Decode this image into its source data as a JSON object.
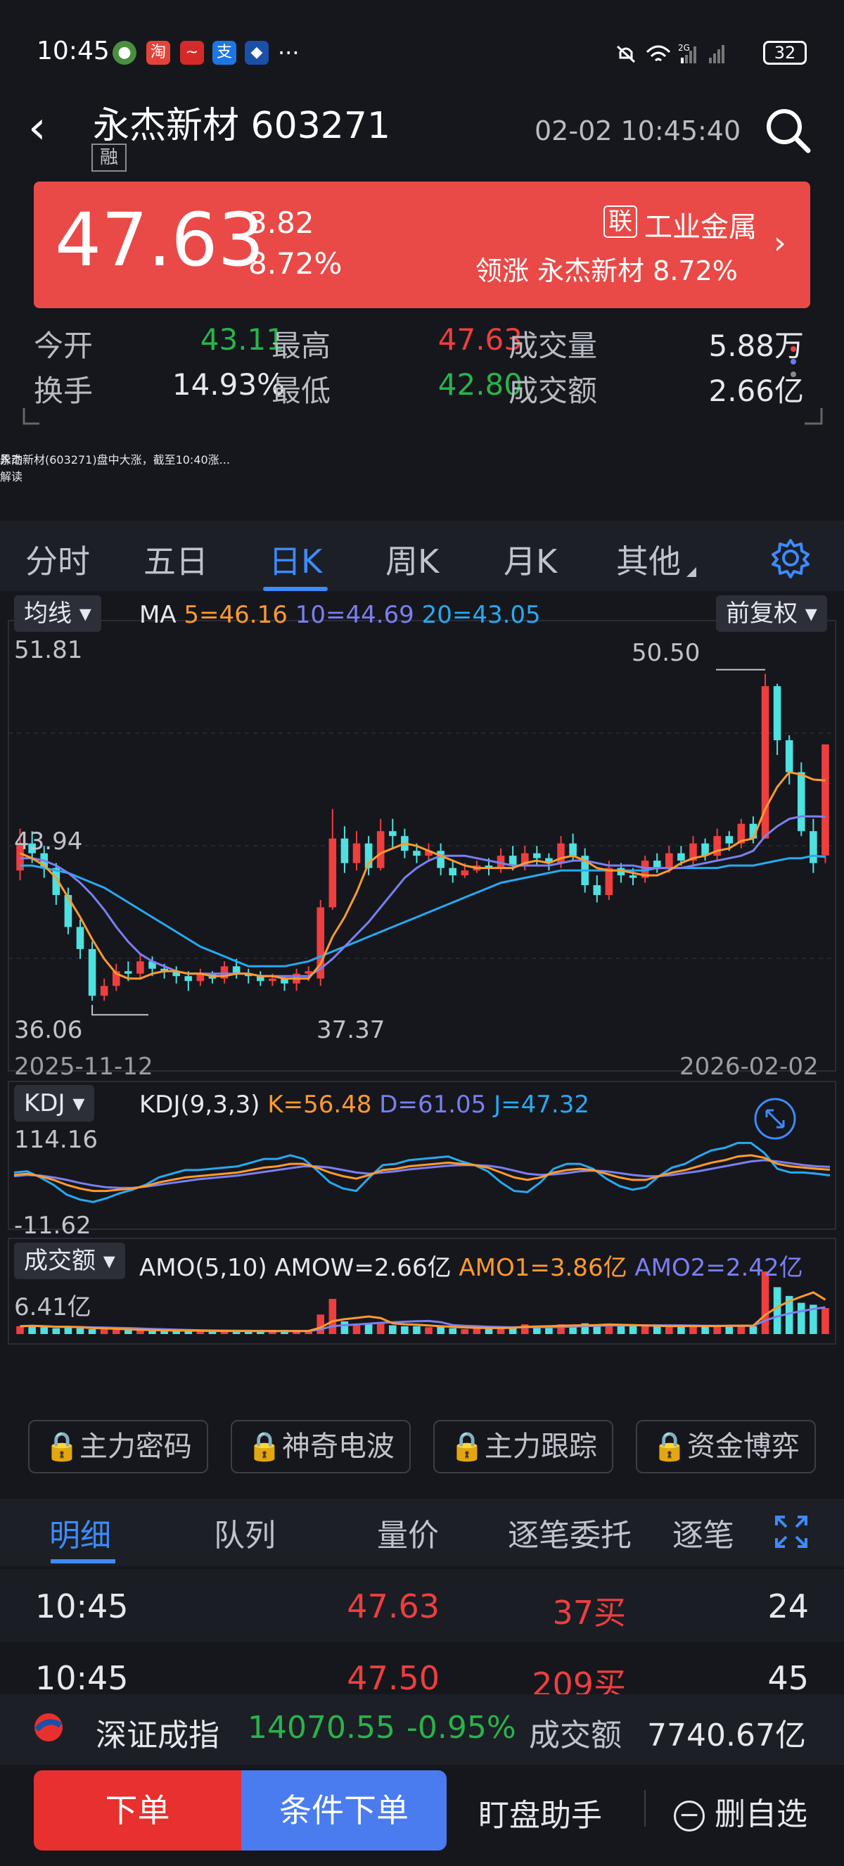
{
  "status_bar": {
    "time": "10:45",
    "battery": "32",
    "dots": "···"
  },
  "header": {
    "back": "‹",
    "name": "永杰新材 603271",
    "tag": "融",
    "datetime": "02-02 10:45:40"
  },
  "price": {
    "last": "47.63",
    "change": "3.82",
    "pct": "8.72%",
    "sector_tag": "联",
    "sector": "工业金属",
    "leading": "领涨 永杰新材 8.72%"
  },
  "stats": {
    "open_label": "今开",
    "open": "43.11",
    "high_label": "最高",
    "high": "47.63",
    "vol_label": "成交量",
    "vol": "5.88万",
    "turnover_label": "换手",
    "turnover": "14.93%",
    "low_label": "最低",
    "low": "42.80",
    "amt_label": "成交额",
    "amt": "2.66亿"
  },
  "news": {
    "badge": "异动\n解读",
    "text": "永杰新材(603271)盘中大涨，截至10:40涨..."
  },
  "tabs": [
    "分时",
    "五日",
    "日K",
    "周K",
    "月K",
    "其他"
  ],
  "ma": {
    "btn": "均线",
    "label": "MA",
    "ma5": "5=46.16",
    "ma10": "10=44.69",
    "ma20": "20=43.05",
    "adj": "前复权"
  },
  "kchart": {
    "ymax": "51.81",
    "ymid": "43.94",
    "ymin": "36.06",
    "hi_mark": "50.50",
    "lo_mark": "37.37",
    "date_start": "2025-11-12",
    "date_end": "2026-02-02"
  },
  "kdj": {
    "btn": "KDJ",
    "label": "KDJ(9,3,3)",
    "k": "K=56.48",
    "d": "D=61.05",
    "j": "J=47.32",
    "ymax": "114.16",
    "ymin": "-11.62"
  },
  "amo": {
    "btn": "成交额",
    "label": "AMO(5,10)",
    "amow": "AMOW=2.66亿",
    "amo1": "AMO1=3.86亿",
    "amo2": "AMO2=2.42亿",
    "ymax": "6.41亿"
  },
  "locks": [
    "主力密码",
    "神奇电波",
    "主力跟踪",
    "资金博弈"
  ],
  "detail_tabs": [
    "明细",
    "队列",
    "量价",
    "逐笔委托",
    "逐笔"
  ],
  "trades": [
    {
      "time": "10:45",
      "price": "47.63",
      "vol": "37买",
      "num": "24"
    },
    {
      "time": "10:45",
      "price": "47.50",
      "vol": "209买",
      "num": "45"
    }
  ],
  "index": {
    "name": "深证成指",
    "value": "14070.55",
    "pct": "-0.95%",
    "amt_label": "成交额",
    "amt": "7740.67亿"
  },
  "actions": {
    "order": "下单",
    "cond_order": "条件下单",
    "assistant": "盯盘助手",
    "remove": "删自选"
  },
  "colors": {
    "up": "#ef3e3e",
    "down": "#4fe0e0",
    "ma5": "#ff9a2e",
    "ma10": "#7b7ff0",
    "ma20": "#28a9f0",
    "accent": "#3c8bff"
  },
  "chart_data": {
    "type": "candlestick",
    "title": "",
    "ylim": [
      36.06,
      51.81
    ],
    "x_range": [
      "2025-11-12",
      "2026-02-02"
    ],
    "candles": [
      [
        42.5,
        43.6,
        44.2,
        42.1
      ],
      [
        43.6,
        43.2,
        44.1,
        42.8
      ],
      [
        43.2,
        42.6,
        43.5,
        42.2
      ],
      [
        42.6,
        41.5,
        42.8,
        41.1
      ],
      [
        41.5,
        40.2,
        41.8,
        39.9
      ],
      [
        40.2,
        39.3,
        40.5,
        38.9
      ],
      [
        39.3,
        37.4,
        39.6,
        37.2
      ],
      [
        37.4,
        37.8,
        38.1,
        37.2
      ],
      [
        37.8,
        38.4,
        38.7,
        37.6
      ],
      [
        38.4,
        38.3,
        38.8,
        38.0
      ],
      [
        38.3,
        38.8,
        39.1,
        38.1
      ],
      [
        38.8,
        38.5,
        39.0,
        38.2
      ],
      [
        38.5,
        38.4,
        38.7,
        38.1
      ],
      [
        38.4,
        38.2,
        38.6,
        37.9
      ],
      [
        38.2,
        38.0,
        38.4,
        37.6
      ],
      [
        38.0,
        38.3,
        38.5,
        37.8
      ],
      [
        38.3,
        38.1,
        38.4,
        37.9
      ],
      [
        38.1,
        38.6,
        38.8,
        37.9
      ],
      [
        38.6,
        38.3,
        38.9,
        38.1
      ],
      [
        38.3,
        38.2,
        38.5,
        37.9
      ],
      [
        38.2,
        38.0,
        38.4,
        37.8
      ],
      [
        38.0,
        38.1,
        38.3,
        37.8
      ],
      [
        38.1,
        37.9,
        38.2,
        37.6
      ],
      [
        37.9,
        38.3,
        38.5,
        37.6
      ],
      [
        38.3,
        38.4,
        38.6,
        38.0
      ],
      [
        38.1,
        41.0,
        41.3,
        37.8
      ],
      [
        41.0,
        43.8,
        45.0,
        40.9
      ],
      [
        43.8,
        42.8,
        44.3,
        42.4
      ],
      [
        42.8,
        43.6,
        44.1,
        42.5
      ],
      [
        43.6,
        42.6,
        43.9,
        42.3
      ],
      [
        42.6,
        44.1,
        44.6,
        42.5
      ],
      [
        44.1,
        43.9,
        44.6,
        43.4
      ],
      [
        43.9,
        43.3,
        44.2,
        43.0
      ],
      [
        43.3,
        43.1,
        43.6,
        42.8
      ],
      [
        43.1,
        43.3,
        43.6,
        42.9
      ],
      [
        43.3,
        42.6,
        43.6,
        42.3
      ],
      [
        42.6,
        42.3,
        42.9,
        42.0
      ],
      [
        42.3,
        42.5,
        42.8,
        42.2
      ],
      [
        42.5,
        42.7,
        42.9,
        42.4
      ],
      [
        42.7,
        42.6,
        43.0,
        42.3
      ],
      [
        42.6,
        43.1,
        43.4,
        42.4
      ],
      [
        43.1,
        42.7,
        43.5,
        42.5
      ],
      [
        42.7,
        43.2,
        43.5,
        42.5
      ],
      [
        43.2,
        43.0,
        43.5,
        42.7
      ],
      [
        43.0,
        42.8,
        43.2,
        42.5
      ],
      [
        42.8,
        43.6,
        43.9,
        42.6
      ],
      [
        43.6,
        43.1,
        44.0,
        42.9
      ],
      [
        43.1,
        41.9,
        43.4,
        41.6
      ],
      [
        41.9,
        41.5,
        42.3,
        41.2
      ],
      [
        41.5,
        42.6,
        42.9,
        41.3
      ],
      [
        42.6,
        42.3,
        42.8,
        42.0
      ],
      [
        42.3,
        42.2,
        42.6,
        41.9
      ],
      [
        42.2,
        42.9,
        43.1,
        42.0
      ],
      [
        42.9,
        42.6,
        43.2,
        42.4
      ],
      [
        42.6,
        43.2,
        43.5,
        42.4
      ],
      [
        43.2,
        42.9,
        43.5,
        42.7
      ],
      [
        42.9,
        43.6,
        43.9,
        42.7
      ],
      [
        43.6,
        43.1,
        43.8,
        42.9
      ],
      [
        43.1,
        43.9,
        44.2,
        42.9
      ],
      [
        43.9,
        43.6,
        44.1,
        43.3
      ],
      [
        43.6,
        44.4,
        44.6,
        43.4
      ],
      [
        44.4,
        43.8,
        44.7,
        43.6
      ],
      [
        43.8,
        50.0,
        50.5,
        43.8
      ],
      [
        50.0,
        47.8,
        50.1,
        47.2
      ],
      [
        47.8,
        46.5,
        48.0,
        46.0
      ],
      [
        46.5,
        44.1,
        46.9,
        43.9
      ],
      [
        44.1,
        42.8,
        44.6,
        42.4
      ],
      [
        43.11,
        47.63,
        47.63,
        42.8
      ]
    ],
    "ma5": [
      43.2,
      43.0,
      42.7,
      42.2,
      41.4,
      40.6,
      39.7,
      38.9,
      38.3,
      38.1,
      38.1,
      38.3,
      38.4,
      38.4,
      38.3,
      38.3,
      38.2,
      38.2,
      38.3,
      38.3,
      38.2,
      38.2,
      38.1,
      38.1,
      38.1,
      38.7,
      39.8,
      40.6,
      41.6,
      42.8,
      43.2,
      43.4,
      43.6,
      43.5,
      43.3,
      43.1,
      42.9,
      42.7,
      42.6,
      42.6,
      42.6,
      42.6,
      42.8,
      42.9,
      42.8,
      43.0,
      43.1,
      42.9,
      42.6,
      42.5,
      42.5,
      42.4,
      42.3,
      42.3,
      42.5,
      42.8,
      43.0,
      43.1,
      43.3,
      43.4,
      43.7,
      43.8,
      45.0,
      45.9,
      46.5,
      46.4,
      46.2,
      46.16
    ],
    "ma10": [
      43.0,
      43.0,
      42.9,
      42.7,
      42.4,
      42.0,
      41.5,
      40.9,
      40.2,
      39.6,
      39.1,
      38.8,
      38.6,
      38.4,
      38.3,
      38.3,
      38.3,
      38.3,
      38.3,
      38.3,
      38.2,
      38.2,
      38.2,
      38.2,
      38.2,
      38.5,
      38.9,
      39.4,
      39.9,
      40.4,
      41.0,
      41.6,
      42.2,
      42.6,
      42.9,
      43.1,
      43.1,
      43.1,
      43.0,
      42.9,
      42.8,
      42.7,
      42.7,
      42.7,
      42.7,
      42.8,
      42.9,
      42.9,
      42.8,
      42.7,
      42.7,
      42.7,
      42.6,
      42.6,
      42.6,
      42.6,
      42.7,
      42.8,
      42.9,
      43.0,
      43.1,
      43.3,
      43.9,
      44.3,
      44.6,
      44.7,
      44.7,
      44.69
    ],
    "ma20": [
      42.7,
      42.7,
      42.6,
      42.5,
      42.4,
      42.2,
      42.0,
      41.8,
      41.5,
      41.2,
      40.9,
      40.6,
      40.3,
      40.0,
      39.7,
      39.4,
      39.2,
      39.0,
      38.8,
      38.6,
      38.6,
      38.6,
      38.6,
      38.7,
      38.8,
      39.0,
      39.2,
      39.4,
      39.6,
      39.8,
      40.0,
      40.2,
      40.4,
      40.6,
      40.8,
      41.0,
      41.2,
      41.4,
      41.6,
      41.8,
      42.0,
      42.1,
      42.2,
      42.3,
      42.4,
      42.5,
      42.5,
      42.5,
      42.5,
      42.5,
      42.5,
      42.5,
      42.5,
      42.6,
      42.6,
      42.6,
      42.6,
      42.6,
      42.6,
      42.7,
      42.7,
      42.7,
      42.8,
      42.9,
      43.0,
      43.0,
      43.1,
      43.05
    ],
    "kdj_k": [
      48,
      50,
      46,
      40,
      32,
      26,
      22,
      22,
      24,
      26,
      30,
      36,
      40,
      44,
      46,
      48,
      50,
      52,
      56,
      60,
      62,
      66,
      66,
      60,
      52,
      46,
      42,
      48,
      56,
      58,
      62,
      64,
      66,
      68,
      66,
      64,
      60,
      52,
      44,
      40,
      44,
      52,
      56,
      58,
      56,
      50,
      44,
      40,
      40,
      46,
      52,
      56,
      62,
      68,
      72,
      78,
      80,
      76,
      66,
      62,
      60,
      58,
      56.48
    ],
    "kdj_d": [
      46,
      48,
      47,
      44,
      40,
      35,
      31,
      28,
      27,
      27,
      29,
      32,
      35,
      38,
      41,
      43,
      45,
      47,
      50,
      53,
      56,
      59,
      62,
      62,
      60,
      56,
      52,
      50,
      52,
      54,
      57,
      59,
      61,
      63,
      64,
      64,
      63,
      60,
      55,
      50,
      48,
      49,
      51,
      54,
      55,
      54,
      51,
      48,
      46,
      46,
      48,
      51,
      54,
      58,
      62,
      66,
      70,
      72,
      70,
      67,
      64,
      62,
      61.05
    ],
    "kdj_j": [
      52,
      54,
      44,
      32,
      16,
      8,
      4,
      10,
      18,
      24,
      32,
      44,
      50,
      56,
      56,
      58,
      60,
      62,
      68,
      74,
      74,
      80,
      74,
      56,
      36,
      26,
      22,
      44,
      64,
      66,
      72,
      74,
      76,
      78,
      70,
      64,
      54,
      36,
      22,
      20,
      36,
      58,
      66,
      66,
      58,
      42,
      30,
      24,
      28,
      46,
      60,
      66,
      78,
      88,
      92,
      100,
      100,
      84,
      58,
      52,
      52,
      50,
      47.32
    ],
    "amo": [
      0.8,
      0.9,
      0.7,
      0.6,
      0.7,
      0.6,
      0.5,
      0.5,
      0.4,
      0.4,
      0.4,
      0.4,
      0.3,
      0.3,
      0.4,
      0.3,
      0.3,
      0.3,
      0.3,
      0.3,
      0.3,
      0.3,
      0.3,
      0.3,
      0.4,
      2.0,
      3.6,
      1.3,
      1.0,
      1.1,
      1.2,
      0.9,
      0.8,
      0.8,
      0.7,
      0.8,
      0.6,
      0.5,
      0.6,
      0.6,
      0.8,
      0.7,
      1.0,
      0.8,
      0.7,
      1.0,
      0.9,
      1.1,
      0.9,
      1.0,
      0.8,
      0.8,
      0.9,
      0.8,
      0.7,
      0.9,
      0.8,
      0.9,
      0.8,
      0.9,
      0.9,
      0.8,
      6.41,
      4.8,
      3.9,
      3.2,
      3.0,
      2.66
    ]
  }
}
